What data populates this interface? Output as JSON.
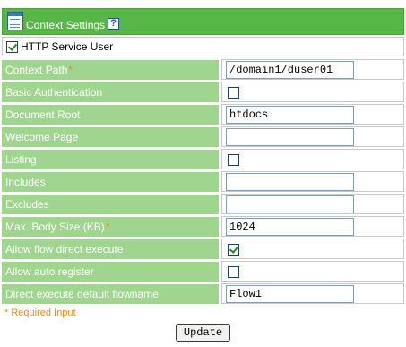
{
  "panel": {
    "title": "Context Settings",
    "help_icon": "?",
    "icon": "settings-document-icon",
    "header_color": "#58b548",
    "label_color": "#9fd58f",
    "required_color": "#f08a1a"
  },
  "service_user": {
    "label": "HTTP Service User",
    "checked": true
  },
  "fields": [
    {
      "key": "context_path",
      "label": "Context Path",
      "required": true,
      "required_mark": "*",
      "type": "text",
      "value": "/domain1/duser01"
    },
    {
      "key": "basic_auth",
      "label": "Basic Authentication",
      "required": false,
      "type": "checkbox",
      "checked": false
    },
    {
      "key": "document_root",
      "label": "Document Root",
      "required": false,
      "type": "text",
      "value": "htdocs"
    },
    {
      "key": "welcome_page",
      "label": "Welcome Page",
      "required": false,
      "type": "text",
      "value": ""
    },
    {
      "key": "listing",
      "label": "Listing",
      "required": false,
      "type": "checkbox",
      "checked": false
    },
    {
      "key": "includes",
      "label": "Includes",
      "required": false,
      "type": "text",
      "value": ""
    },
    {
      "key": "excludes",
      "label": "Excludes",
      "required": false,
      "type": "text",
      "value": ""
    },
    {
      "key": "max_body_size",
      "label": "Max. Body Size (KB)",
      "required": true,
      "required_mark": "*",
      "type": "text",
      "value": "1024"
    },
    {
      "key": "allow_flow_direct_execute",
      "label": "Allow flow direct execute",
      "required": false,
      "type": "checkbox",
      "checked": true
    },
    {
      "key": "allow_auto_register",
      "label": "Allow auto register",
      "required": false,
      "type": "checkbox",
      "checked": false
    },
    {
      "key": "direct_execute_default_flowname",
      "label": "Direct execute default flowname",
      "required": false,
      "type": "text",
      "value": "Flow1"
    }
  ],
  "footnote": "* Required Input",
  "update_button": "Update"
}
